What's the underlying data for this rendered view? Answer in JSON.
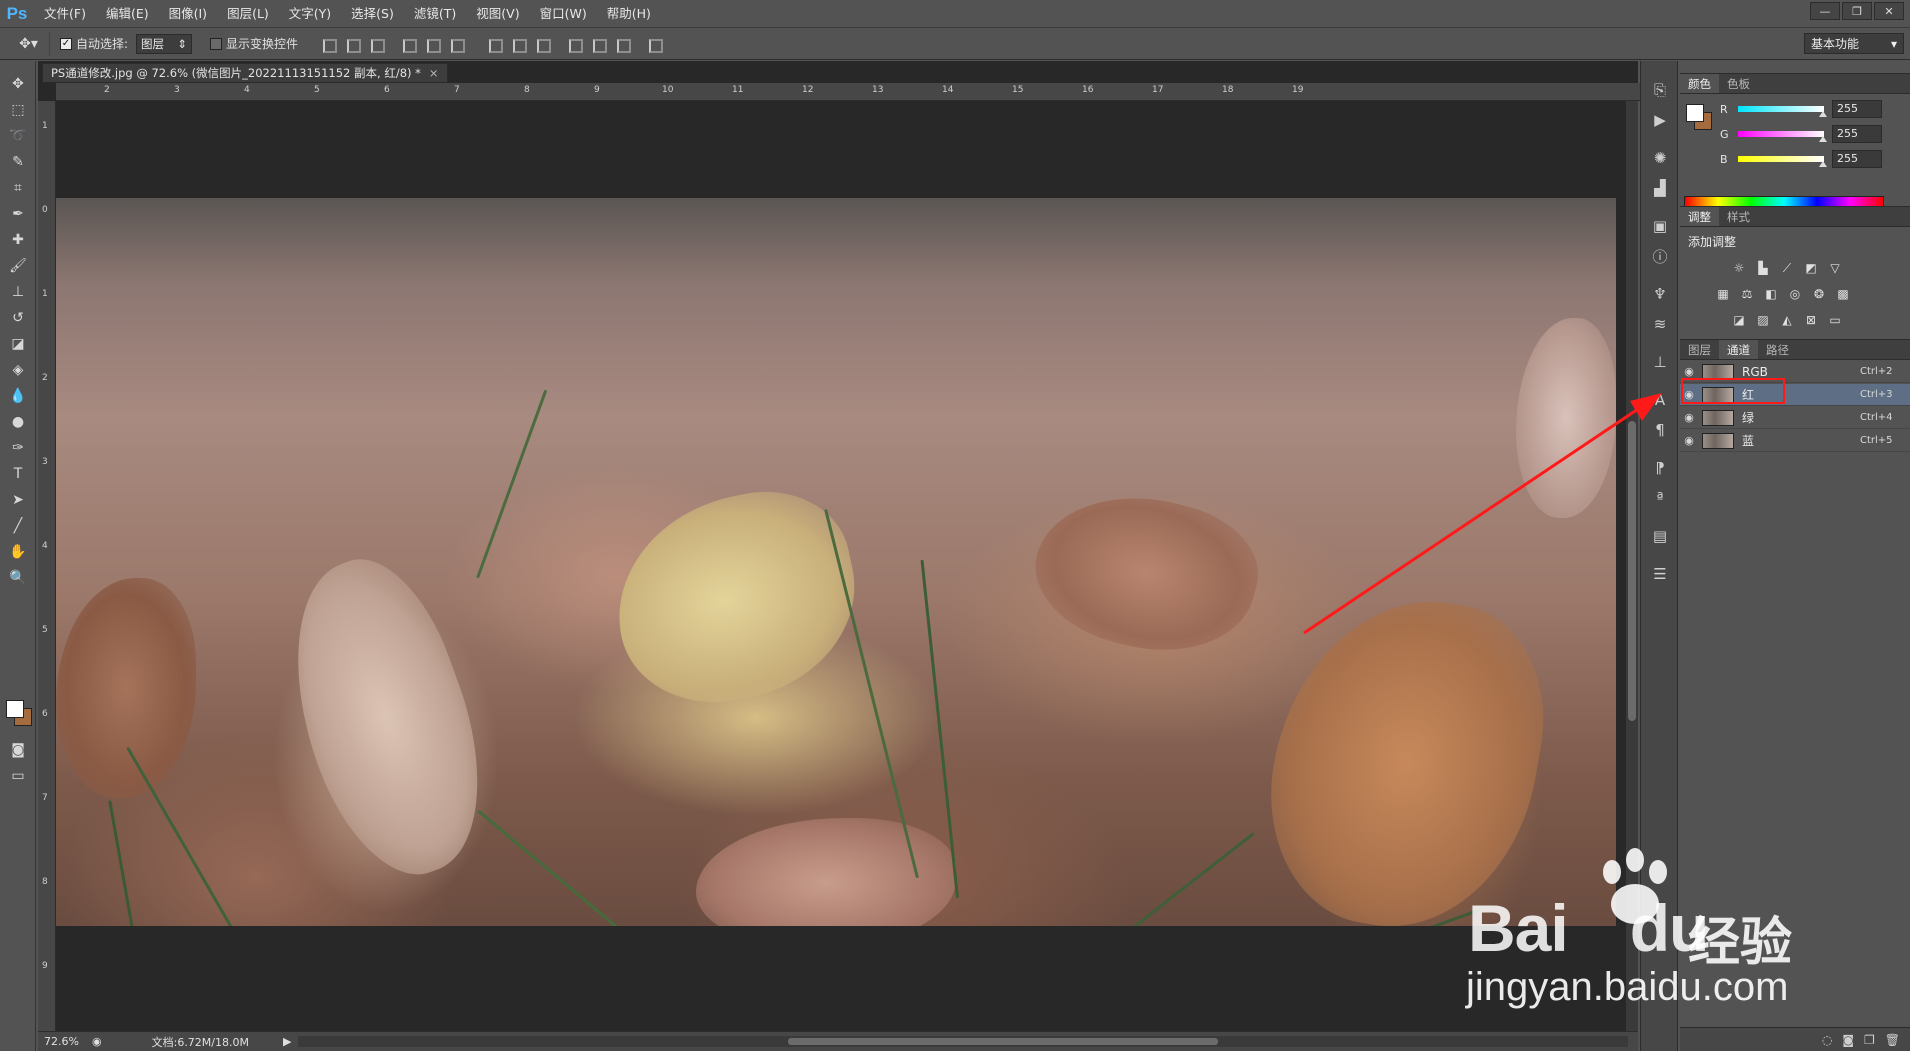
{
  "menubar": {
    "logo": "Ps",
    "items": [
      "文件(F)",
      "编辑(E)",
      "图像(I)",
      "图层(L)",
      "文字(Y)",
      "选择(S)",
      "滤镜(T)",
      "视图(V)",
      "窗口(W)",
      "帮助(H)"
    ]
  },
  "options": {
    "auto_select_label": "自动选择:",
    "auto_select_value": "图层",
    "show_transform_label": "显示变换控件",
    "workspace": "基本功能"
  },
  "document": {
    "tab_title": "PS通道修改.jpg @ 72.6% (微信图片_20221113151152 副本, 红/8) *",
    "zoom": "72.6%",
    "doc_info": "文档:6.72M/18.0M",
    "ruler_top": [
      "2",
      "3",
      "4",
      "5",
      "6",
      "7",
      "8",
      "9",
      "10",
      "11",
      "12",
      "13",
      "14",
      "15",
      "16",
      "17",
      "18",
      "19"
    ],
    "ruler_left": [
      "1",
      "0",
      "1",
      "2",
      "3",
      "4",
      "5",
      "6",
      "7",
      "8",
      "9"
    ]
  },
  "color_panel": {
    "tabs": [
      "颜色",
      "色板"
    ],
    "channels": [
      {
        "label": "R",
        "value": "255",
        "color": "#00e5ff"
      },
      {
        "label": "G",
        "value": "255",
        "color": "#ff00ff"
      },
      {
        "label": "B",
        "value": "255",
        "color": "#ffff00"
      }
    ]
  },
  "adjust_panel": {
    "tabs": [
      "调整",
      "样式"
    ],
    "title": "添加调整"
  },
  "channels_panel": {
    "tabs": [
      "图层",
      "通道",
      "路径"
    ],
    "rows": [
      {
        "name": "RGB",
        "shortcut": "Ctrl+2"
      },
      {
        "name": "红",
        "shortcut": "Ctrl+3"
      },
      {
        "name": "绿",
        "shortcut": "Ctrl+4"
      },
      {
        "name": "蓝",
        "shortcut": "Ctrl+5"
      }
    ]
  },
  "watermark": {
    "brand": "Bai",
    "brand2": "du",
    "cn": "经验",
    "url": "jingyan.baidu.com"
  }
}
